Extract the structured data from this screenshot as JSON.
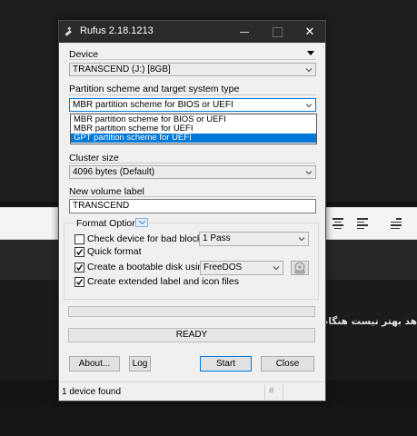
{
  "background": {
    "farsi_text": "هد  بهتر نیست هنگام"
  },
  "window": {
    "title": "Rufus 2.18.1213",
    "close_glyph": "✕"
  },
  "device": {
    "label": "Device",
    "value": "TRANSCEND (J:) [8GB]"
  },
  "partition": {
    "label": "Partition scheme and target system type",
    "value": "MBR partition scheme for BIOS or UEFI",
    "options": [
      "MBR partition scheme for BIOS or UEFI",
      "MBR partition scheme for UEFI",
      "GPT partition scheme for UEFI"
    ],
    "selected_option": "GPT partition scheme for UEFI"
  },
  "cluster": {
    "label": "Cluster size",
    "value": "4096 bytes (Default)"
  },
  "volume": {
    "label": "New volume label",
    "value": "TRANSCEND"
  },
  "format_options": {
    "title": "Format Options",
    "bad_blocks": {
      "label": "Check device for bad blocks",
      "checked": false,
      "passes": "1 Pass"
    },
    "quick_format": {
      "label": "Quick format",
      "checked": true
    },
    "bootable": {
      "label": "Create a bootable disk using",
      "checked": true,
      "source": "FreeDOS"
    },
    "extended_label": {
      "label": "Create extended label and icon files",
      "checked": true
    }
  },
  "progress": {
    "fraction": 0
  },
  "status": "READY",
  "buttons": {
    "about": "About...",
    "log": "Log",
    "start": "Start",
    "close": "Close"
  },
  "statusbar": {
    "device_count": "1 device found",
    "hash_glyph": "#"
  }
}
